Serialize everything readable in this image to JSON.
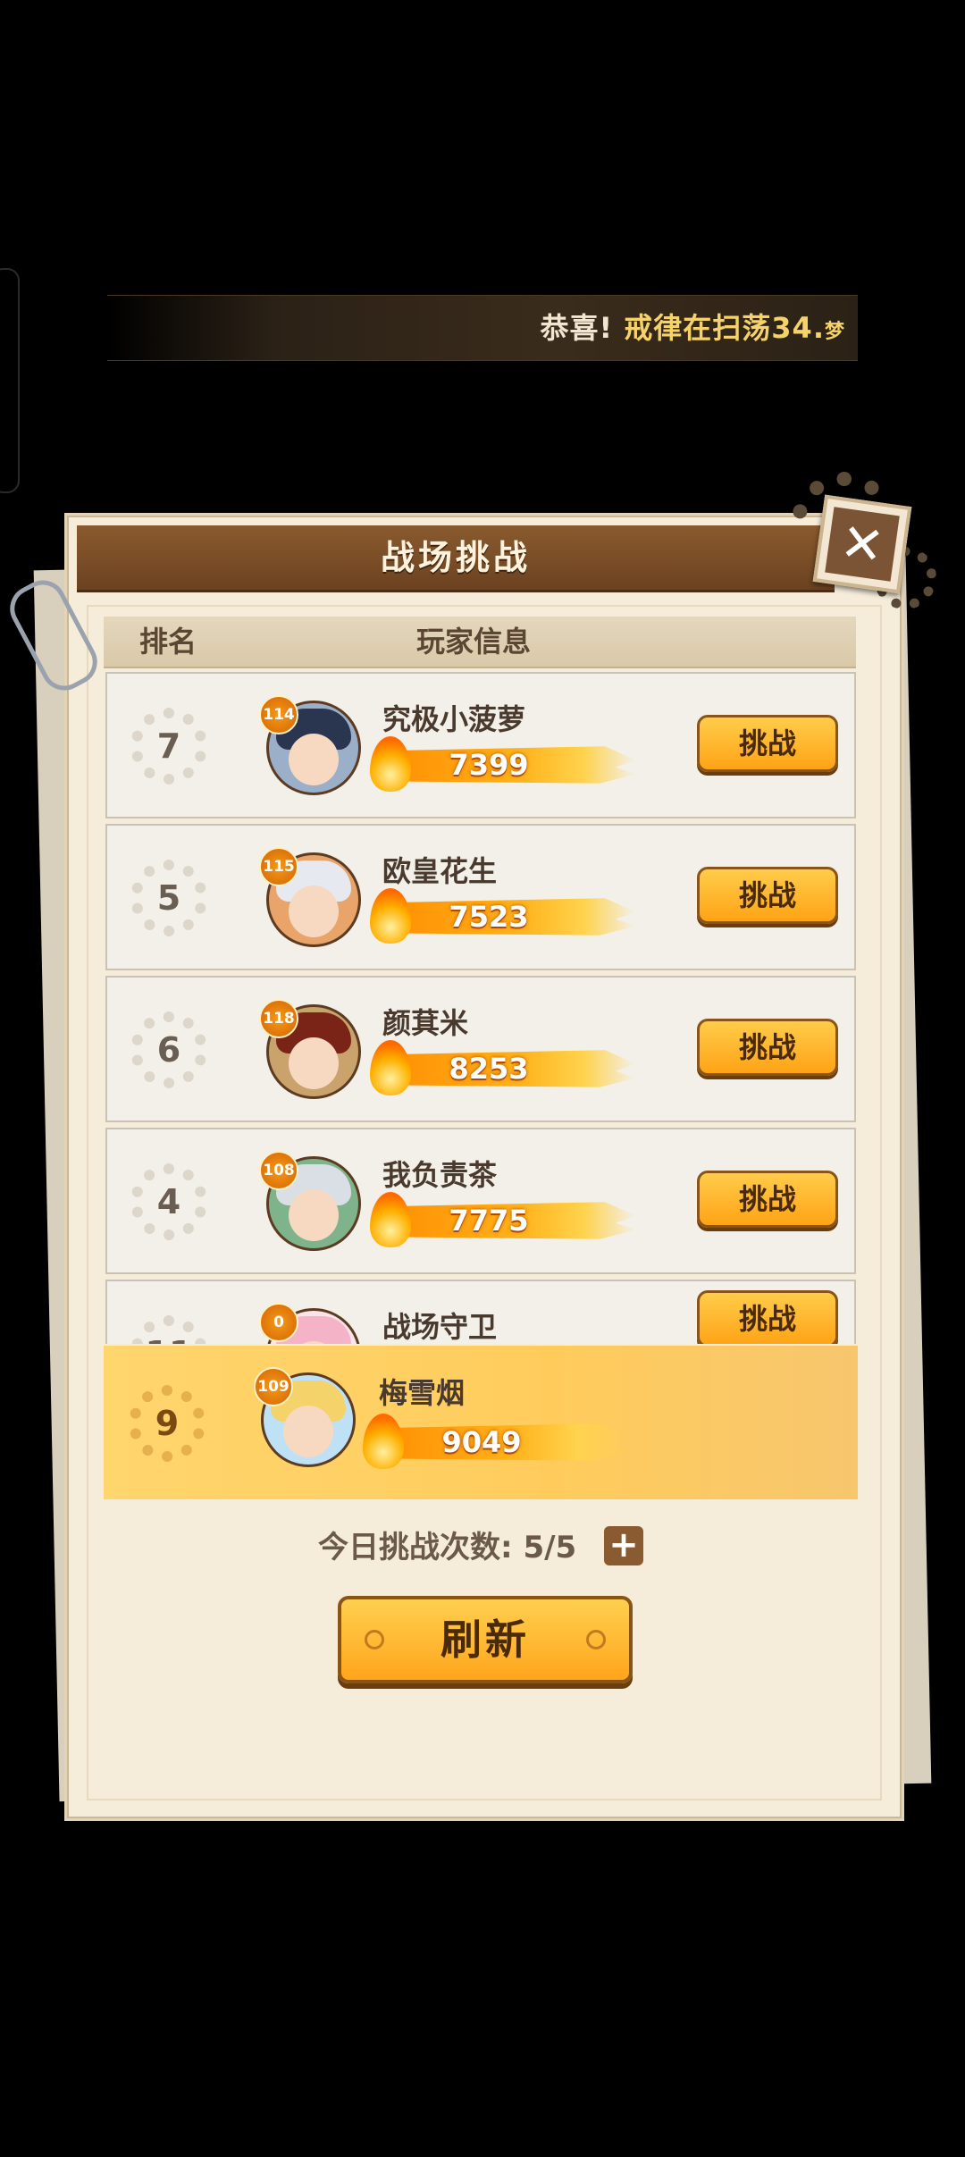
{
  "marquee": {
    "prefix": "恭喜! ",
    "name": "戒律在",
    "tail": "扫荡34.",
    "cut": "梦"
  },
  "panel": {
    "title": "战场挑战",
    "close_glyph": "✕"
  },
  "headers": {
    "rank": "排名",
    "player_info": "玩家信息"
  },
  "challenge_label": "挑战",
  "players": [
    {
      "rank": "7",
      "level": "114",
      "name": "究极小菠萝",
      "power": "7399",
      "hair": "#2a3550"
    },
    {
      "rank": "5",
      "level": "115",
      "name": "欧皇花生",
      "power": "7523",
      "hair": "#e6e9ef"
    },
    {
      "rank": "6",
      "level": "118",
      "name": "颜萁米",
      "power": "8253",
      "hair": "#7a2418"
    },
    {
      "rank": "4",
      "level": "108",
      "name": "我负责茶",
      "power": "7775",
      "hair": "#d9dfe4"
    },
    {
      "rank": "11",
      "level": "0",
      "name": "战场守卫",
      "power": "",
      "hair": "#f5b3c8"
    }
  ],
  "self": {
    "rank": "9",
    "level": "109",
    "name": "梅雪烟",
    "power": "9049",
    "hair": "#f3d36a"
  },
  "daily": {
    "label": "今日挑战次数:",
    "value": "5/5",
    "plus": "+"
  },
  "refresh_label": "刷新",
  "colors": {
    "accent": "#ffa316",
    "title_bar": "#6b4220",
    "self_row": "#ffd56e"
  }
}
